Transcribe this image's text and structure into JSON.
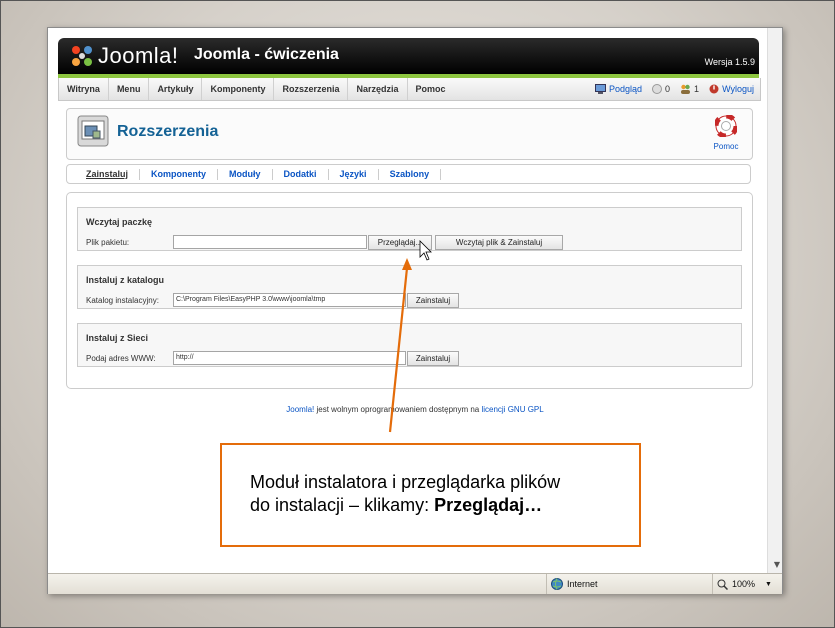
{
  "header": {
    "logo_text": "Joomla!",
    "site_name": "Joomla - ćwiczenia",
    "version": "Wersja 1.5.9"
  },
  "menu": {
    "items": [
      "Witryna",
      "Menu",
      "Artykuły",
      "Komponenty",
      "Rozszerzenia",
      "Narzędzia",
      "Pomoc"
    ]
  },
  "status": {
    "preview": "Podgląd",
    "messages": "0",
    "users": "1",
    "logout": "Wyloguj"
  },
  "toolbar": {
    "title": "Rozszerzenia",
    "help": "Pomoc"
  },
  "submenu": {
    "items": [
      "Zainstaluj",
      "Komponenty",
      "Moduły",
      "Dodatki",
      "Języki",
      "Szablony"
    ]
  },
  "upload": {
    "title": "Wczytaj paczkę",
    "label": "Plik pakietu:",
    "browse": "Przeglądaj...",
    "submit": "Wczytaj plik & Zainstaluj"
  },
  "directory": {
    "title": "Instaluj z katalogu",
    "label": "Katalog instalacyjny:",
    "value": "C:\\Program Files\\EasyPHP 3.0\\www\\joomla\\tmp",
    "submit": "Zainstaluj"
  },
  "url": {
    "title": "Instaluj z Sieci",
    "label": "Podaj adres WWW:",
    "value": "http://",
    "submit": "Zainstaluj"
  },
  "footer": {
    "link1": "Joomla!",
    "text": " jest wolnym oprogramowaniem dostępnym na ",
    "link2": "licencji GNU GPL"
  },
  "browser_status": {
    "zone": "Internet",
    "zoom": "100%"
  },
  "callout": {
    "line1": "Moduł instalatora i przeglądarka plików",
    "line2": "do instalacji – klikamy: ",
    "bold": "Przeglądaj…"
  },
  "colors": {
    "callout_border": "#e46c0a",
    "header_accent": "#8dc63f",
    "link": "#0b55c4",
    "title": "#146295"
  }
}
